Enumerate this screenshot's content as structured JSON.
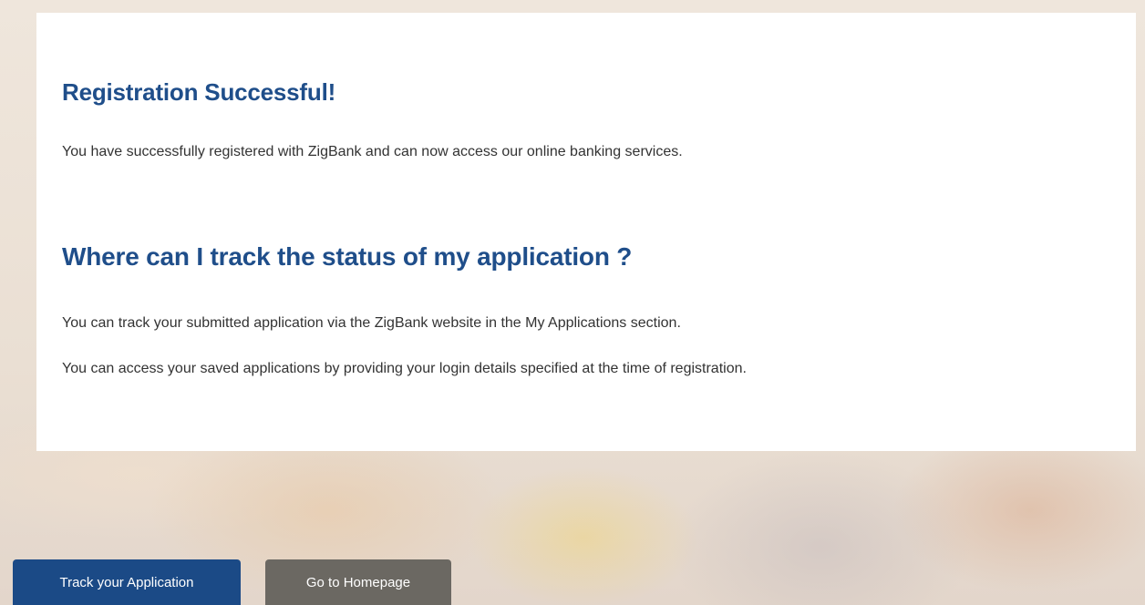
{
  "confirmation": {
    "success_title": "Registration Successful!",
    "success_message": "You have successfully registered with ZigBank and can now access our online banking services.",
    "tracking_title": "Where can I track the status of my application ?",
    "tracking_info_1": "You can track your submitted application via the ZigBank website in the My Applications section.",
    "tracking_info_2": "You can access your saved applications by providing your login details specified at the time of registration."
  },
  "actions": {
    "track_label": "Track your Application",
    "home_label": "Go to Homepage"
  },
  "colors": {
    "heading": "#1f4e8a",
    "primary_button": "#1b4a86",
    "secondary_button": "#6b6862"
  }
}
